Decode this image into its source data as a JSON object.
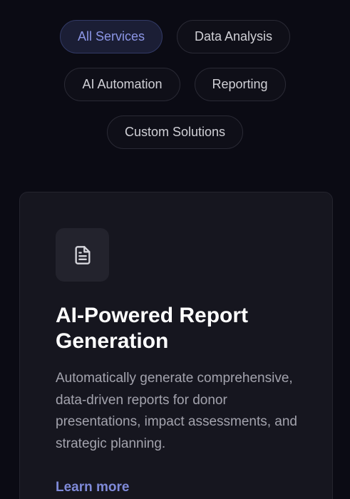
{
  "filters": {
    "all_services": "All Services",
    "data_analysis": "Data Analysis",
    "ai_automation": "AI Automation",
    "reporting": "Reporting",
    "custom_solutions": "Custom Solutions",
    "active": "All Services"
  },
  "card": {
    "icon": "document-icon",
    "title": "AI-Powered Report Generation",
    "description": "Automatically generate comprehensive, data-driven reports for donor presentations, impact assessments, and strategic planning.",
    "link": "Learn more"
  },
  "colors": {
    "background": "#0b0b14",
    "accent": "#7f8ad9",
    "card": "#16161f"
  }
}
